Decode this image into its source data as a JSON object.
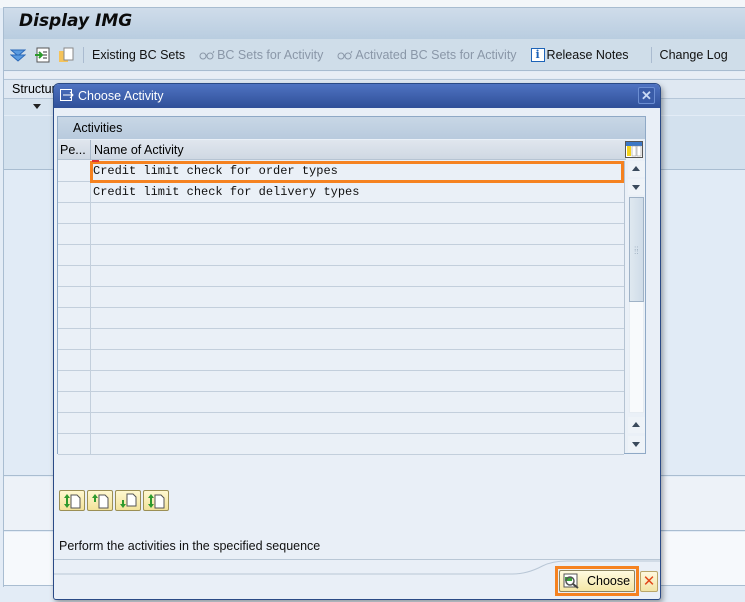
{
  "window": {
    "title": "Display IMG"
  },
  "toolbar": {
    "icons": [
      "expand-all-icon",
      "import-icon",
      "copy-icon"
    ],
    "buttons": [
      {
        "label": "Existing BC Sets",
        "enabled": true
      },
      {
        "label": "BC Sets for Activity",
        "enabled": false,
        "icon": "glasses-icon"
      },
      {
        "label": "Activated BC Sets for Activity",
        "enabled": false,
        "icon": "glasses-icon"
      },
      {
        "label": "Release Notes",
        "enabled": true,
        "icon": "info-icon"
      },
      {
        "label": "Change Log",
        "enabled": true
      }
    ]
  },
  "structure": {
    "label": "Structure"
  },
  "dialog": {
    "title": "Choose Activity",
    "close_label": "✕",
    "table": {
      "caption": "Activities",
      "columns": [
        "Pe...",
        "Name of Activity"
      ],
      "rows": [
        {
          "pe": "",
          "name": "Credit limit check for order types",
          "highlighted": true
        },
        {
          "pe": "",
          "name": "Credit limit check for delivery types",
          "highlighted": false
        }
      ],
      "empty_rows": 12
    },
    "sequence_buttons": [
      "move-to-top",
      "move-up",
      "move-down",
      "move-to-bottom"
    ],
    "hint": "Perform the activities in the specified sequence",
    "choose_label": "Choose",
    "cancel_label": "✕"
  },
  "colors": {
    "highlight": "#f58220",
    "dialog_title_bg": "#2f4f98",
    "cancel_icon": "#e2481b"
  }
}
